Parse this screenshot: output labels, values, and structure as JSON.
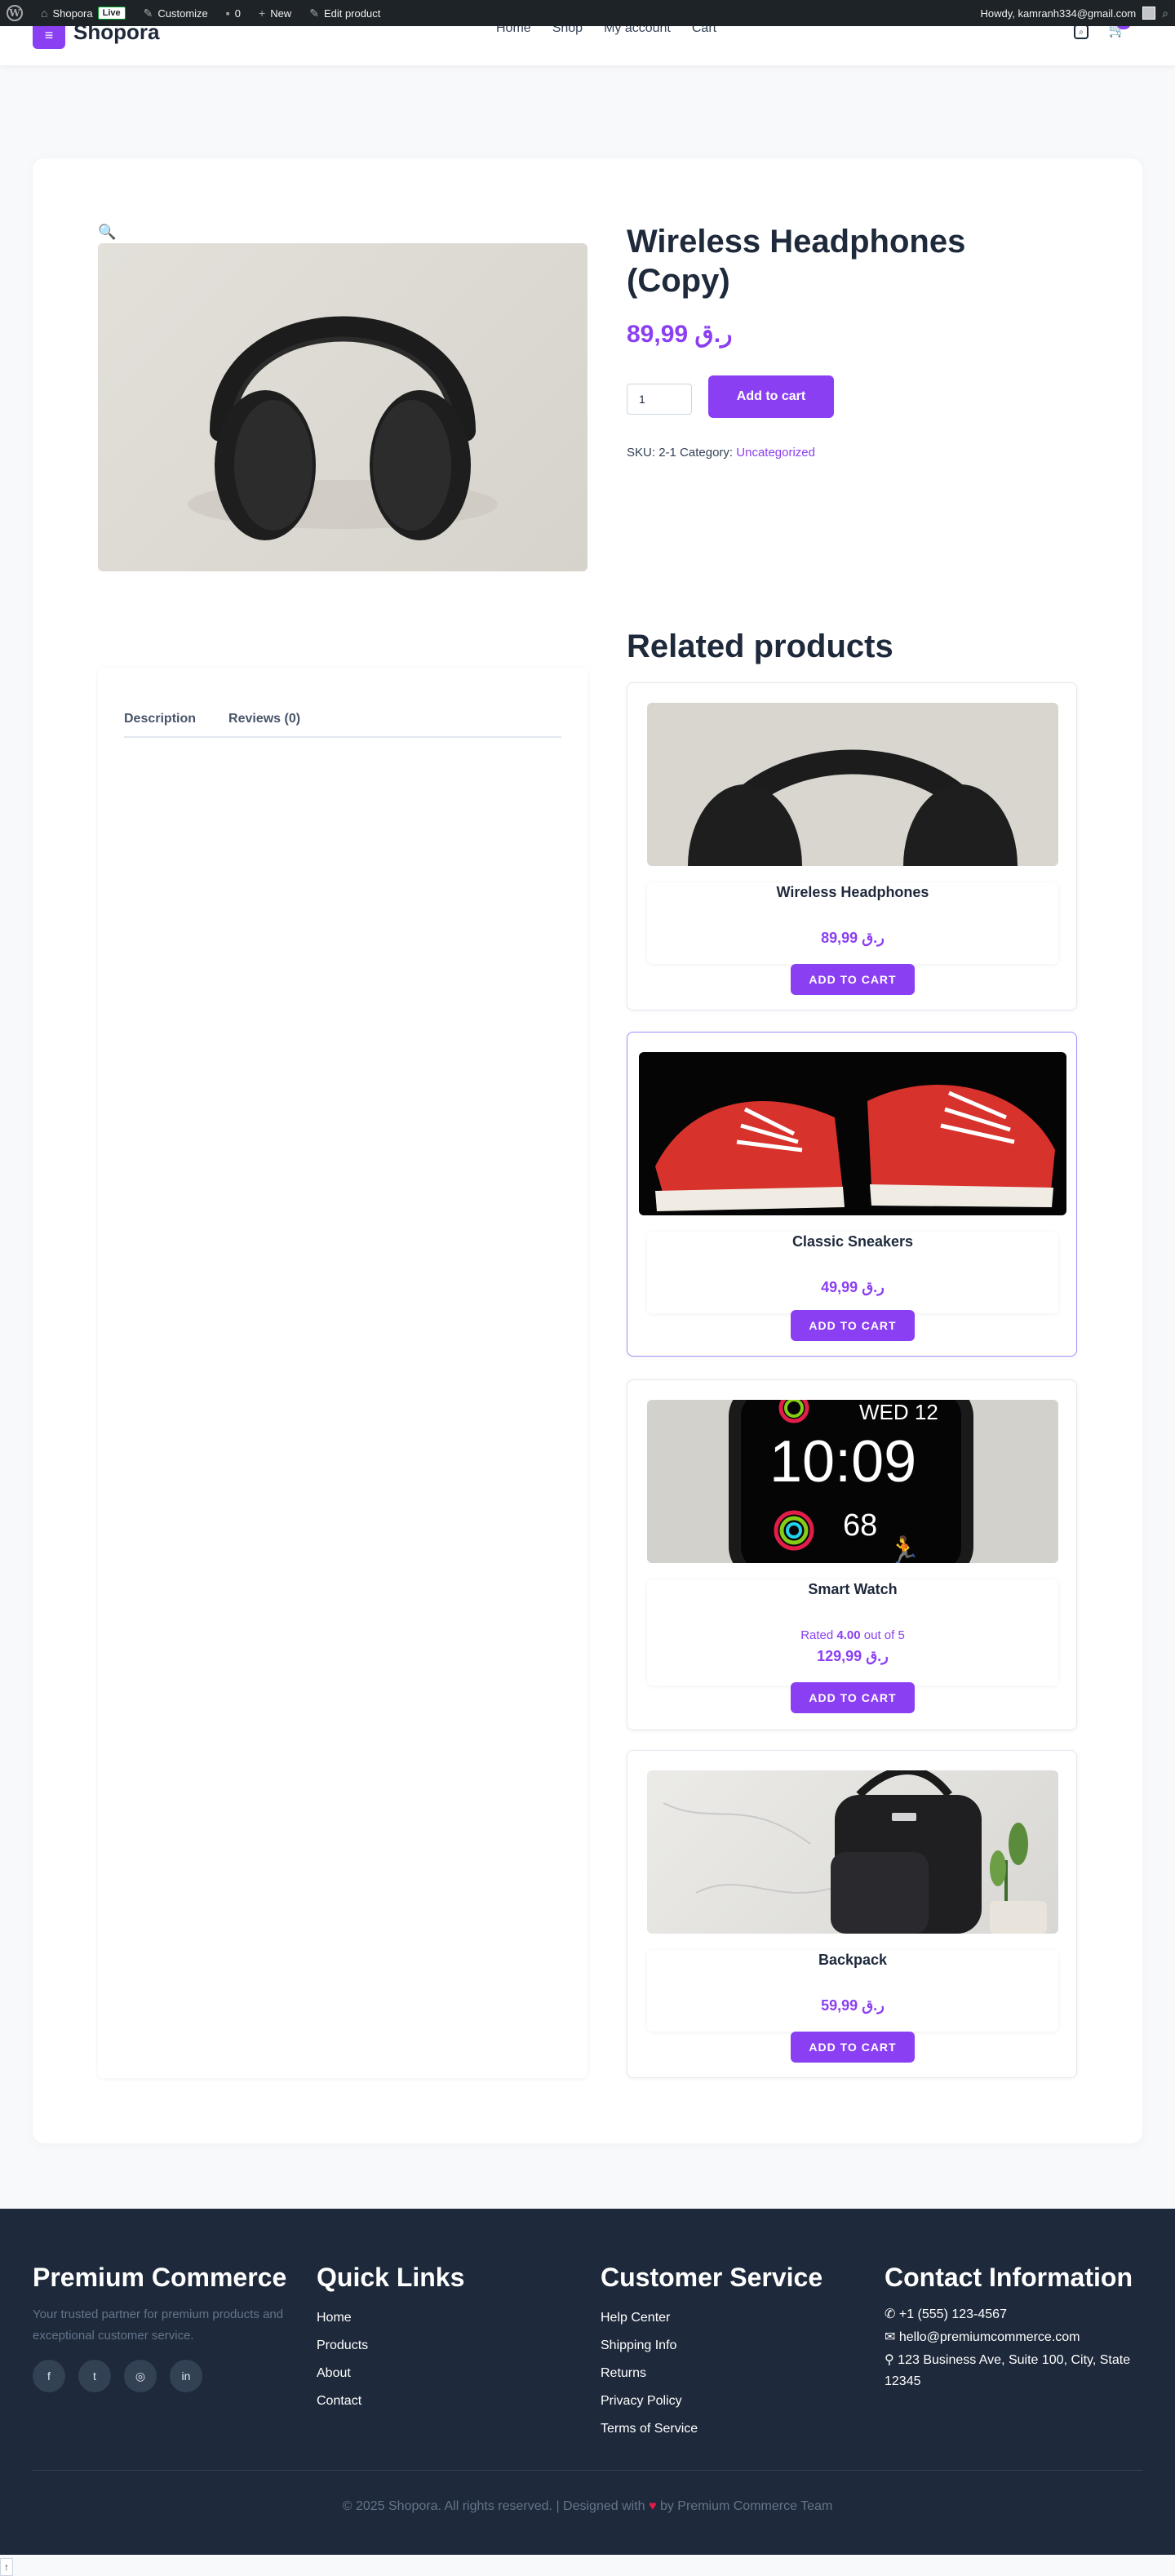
{
  "admin_bar": {
    "site_name": "Shopora",
    "live_badge": "Live",
    "customize": "Customize",
    "comments_count": "0",
    "new": "New",
    "edit_product": "Edit product",
    "howdy": "Howdy, kamranh334@gmail.com"
  },
  "header": {
    "logo": "Shopora",
    "nav": [
      "Home",
      "Shop",
      "My account",
      "Cart"
    ],
    "cart_count": "0"
  },
  "product": {
    "title": "Wireless Headphones (Copy)",
    "price": "ر.ق 89,99",
    "quantity": "1",
    "add_to_cart": "Add to cart",
    "sku_label": "SKU:",
    "sku": "2-1",
    "category_label": "Category:",
    "category": "Uncategorized"
  },
  "tabs": [
    "Description",
    "Reviews (0)"
  ],
  "related": {
    "title": "Related products",
    "items": [
      {
        "name": "Wireless Headphones",
        "price": "ر.ق 89,99",
        "button": "ADD TO CART"
      },
      {
        "name": "Classic Sneakers",
        "price": "ر.ق 49,99",
        "button": "ADD TO CART"
      },
      {
        "name": "Smart Watch",
        "rating_prefix": "Rated",
        "rating": "4.00",
        "rating_suffix": "out of 5",
        "price": "ر.ق 129,99",
        "button": "ADD TO CART",
        "watch_day": "WED 12",
        "watch_time": "10:09",
        "watch_num": "68"
      },
      {
        "name": "Backpack",
        "price": "ر.ق 59,99",
        "button": "ADD TO CART"
      }
    ]
  },
  "footer": {
    "brand": {
      "title": "Premium Commerce",
      "desc": "Your trusted partner for premium products and exceptional customer service."
    },
    "quick_links": {
      "title": "Quick Links",
      "links": [
        "Home",
        "Products",
        "About",
        "Contact"
      ]
    },
    "customer_service": {
      "title": "Customer Service",
      "links": [
        "Help Center",
        "Shipping Info",
        "Returns",
        "Privacy Policy",
        "Terms of Service"
      ]
    },
    "contact": {
      "title": "Contact Information",
      "phone": "+1 (555) 123-4567",
      "email": "hello@premiumcommerce.com",
      "address": "123 Business Ave, Suite 100, City, State 12345"
    },
    "copyright": "© 2025 Shopora. All rights reserved.",
    "designed_prefix": "| Designed with",
    "designed_suffix": "by Premium Commerce Team"
  },
  "colors": {
    "accent": "#8b3ff2",
    "footer_bg": "#1e293b",
    "admin_bar": "#1d2327"
  }
}
